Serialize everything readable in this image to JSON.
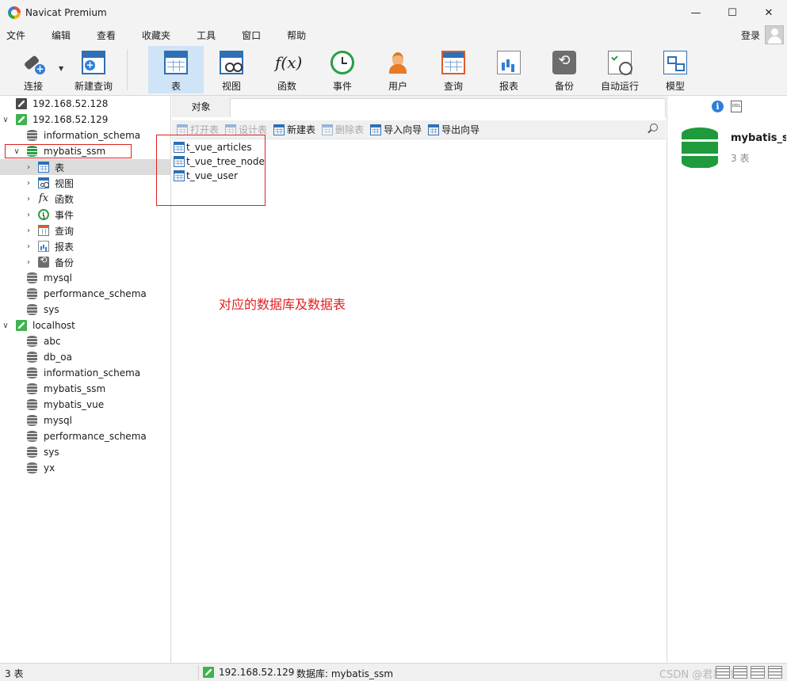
{
  "window": {
    "title": "Navicat Premium"
  },
  "menu": [
    "文件",
    "编辑",
    "查看",
    "收藏夹",
    "工具",
    "窗口",
    "帮助"
  ],
  "login_label": "登录",
  "toolbar": [
    {
      "label": "连接",
      "icon": "connection-plug-icon"
    },
    {
      "label": "新建查询",
      "icon": "new-query-icon"
    },
    {
      "label": "表",
      "icon": "table-icon",
      "active": true
    },
    {
      "label": "视图",
      "icon": "view-icon"
    },
    {
      "label": "函数",
      "icon": "function-fx-icon"
    },
    {
      "label": "事件",
      "icon": "event-clock-icon"
    },
    {
      "label": "用户",
      "icon": "user-icon"
    },
    {
      "label": "查询",
      "icon": "query-icon"
    },
    {
      "label": "报表",
      "icon": "report-icon"
    },
    {
      "label": "备份",
      "icon": "backup-icon"
    },
    {
      "label": "自动运行",
      "icon": "automation-icon"
    },
    {
      "label": "模型",
      "icon": "model-icon"
    }
  ],
  "tree": [
    {
      "label": "192.168.52.128",
      "icon": "server-icon",
      "level": 0,
      "caret": ""
    },
    {
      "label": "192.168.52.129",
      "icon": "server-connected-icon",
      "level": 0,
      "caret": "open"
    },
    {
      "label": "information_schema",
      "icon": "database-icon",
      "level": 1,
      "caret": ""
    },
    {
      "label": "mybatis_ssm",
      "icon": "database-open-icon",
      "level": 1,
      "caret": "open",
      "highlighted": true
    },
    {
      "label": "表",
      "icon": "table-icon",
      "level": 2,
      "caret": "closed",
      "selected": true
    },
    {
      "label": "视图",
      "icon": "view-icon",
      "level": 2,
      "caret": "closed"
    },
    {
      "label": "函数",
      "icon": "function-icon",
      "level": 2,
      "caret": "closed"
    },
    {
      "label": "事件",
      "icon": "event-icon",
      "level": 2,
      "caret": "closed"
    },
    {
      "label": "查询",
      "icon": "query-icon",
      "level": 2,
      "caret": "closed"
    },
    {
      "label": "报表",
      "icon": "report-icon",
      "level": 2,
      "caret": "closed"
    },
    {
      "label": "备份",
      "icon": "backup-icon",
      "level": 2,
      "caret": "closed"
    },
    {
      "label": "mysql",
      "icon": "database-icon",
      "level": 1,
      "caret": ""
    },
    {
      "label": "performance_schema",
      "icon": "database-icon",
      "level": 1,
      "caret": ""
    },
    {
      "label": "sys",
      "icon": "database-icon",
      "level": 1,
      "caret": ""
    },
    {
      "label": "localhost",
      "icon": "server-connected-icon",
      "level": 0,
      "caret": "open"
    },
    {
      "label": "abc",
      "icon": "database-icon",
      "level": 1,
      "caret": ""
    },
    {
      "label": "db_oa",
      "icon": "database-icon",
      "level": 1,
      "caret": ""
    },
    {
      "label": "information_schema",
      "icon": "database-icon",
      "level": 1,
      "caret": ""
    },
    {
      "label": "mybatis_ssm",
      "icon": "database-icon",
      "level": 1,
      "caret": ""
    },
    {
      "label": "mybatis_vue",
      "icon": "database-icon",
      "level": 1,
      "caret": ""
    },
    {
      "label": "mysql",
      "icon": "database-icon",
      "level": 1,
      "caret": ""
    },
    {
      "label": "performance_schema",
      "icon": "database-icon",
      "level": 1,
      "caret": ""
    },
    {
      "label": "sys",
      "icon": "database-icon",
      "level": 1,
      "caret": ""
    },
    {
      "label": "yx",
      "icon": "database-icon",
      "level": 1,
      "caret": ""
    }
  ],
  "main": {
    "tab_label": "对象",
    "object_toolbar": [
      {
        "label": "打开表",
        "disabled": true
      },
      {
        "label": "设计表",
        "disabled": true
      },
      {
        "label": "新建表",
        "disabled": false
      },
      {
        "label": "删除表",
        "disabled": true
      },
      {
        "label": "导入向导",
        "disabled": false
      },
      {
        "label": "导出向导",
        "disabled": false
      }
    ],
    "tables": [
      "t_vue_articles",
      "t_vue_tree_node",
      "t_vue_user"
    ],
    "annotation": "对应的数据库及数据表"
  },
  "info_panel": {
    "db_name": "mybatis_ssm",
    "table_count": "3 表"
  },
  "status": {
    "count": "3 表",
    "connection": "192.168.52.129",
    "database": "数据库: mybatis_ssm",
    "watermark": "CSDN @君易--鑨"
  },
  "colors": {
    "annotation": "#e02020",
    "accent": "#2f7ed8",
    "db_green": "#2a9d45",
    "selected_row": "#dcdcdc"
  }
}
